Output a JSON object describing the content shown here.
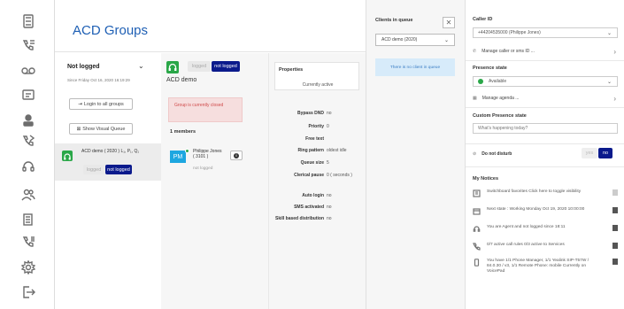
{
  "groups": {
    "title": "ACD Groups",
    "status_label": "Not logged",
    "since": "Since Friday Oct 16, 2020 16:19:29",
    "login_all_btn": "Login to all groups",
    "show_queue_btn": "Show Visual Queue",
    "group_name": "ACD demo ( 2020 ) L₁, P₁, Q₁",
    "group_logged": "logged",
    "group_not_logged": "not logged"
  },
  "detail": {
    "logged": "logged",
    "not_logged": "not logged",
    "name": "ACD demo",
    "closed_text": "Group is currently closed",
    "members_label": "1 members",
    "member_initials": "PM",
    "member_name": "Philippe Jones ( 3101 )",
    "member_status": "not logged"
  },
  "properties": {
    "title": "Properties",
    "status": "Currently active",
    "rows": [
      {
        "k": "Bypass DND",
        "v": "no"
      },
      {
        "k": "Priority",
        "v": "0"
      },
      {
        "k": "Free text",
        "v": ""
      },
      {
        "k": "Ring pattern",
        "v": "oldest idle"
      },
      {
        "k": "Queue size",
        "v": "5"
      },
      {
        "k": "Clerical pause",
        "v": "0 ( seconds )"
      },
      {
        "k": "Auto login",
        "v": "no"
      },
      {
        "k": "SMS activated",
        "v": "no"
      },
      {
        "k": "Skill based distribution",
        "v": "no"
      }
    ]
  },
  "queue": {
    "title": "Clients in queue",
    "select": "ACD demo (2020)",
    "empty": "There is no client in queue"
  },
  "right": {
    "caller_id_title": "Caller ID",
    "caller_id_value": "+44204535000 (Philippe Jones)",
    "manage_caller": "Manage caller or sms ID ...",
    "presence_title": "Presence state",
    "presence_value": "Available",
    "manage_agenda": "Manage agenda ...",
    "custom_presence_title": "Custom Presence state",
    "custom_presence_placeholder": "What's happening today?",
    "dnd_label": "Do not disturb",
    "dnd_yes": "yes",
    "dnd_no": "no",
    "notices_title": "My Notices",
    "notices": [
      {
        "icon": "favorites-icon",
        "text": "Switchboard favorites Click here to toggle visibility"
      },
      {
        "icon": "calendar-icon",
        "text": "Next state : Working Monday Oct 19, 2020 10:00:00"
      },
      {
        "icon": "headset-icon",
        "text": "You are Agent and not logged since 18:11"
      },
      {
        "icon": "call-rules-icon",
        "text": "0/7 active call rules 0/3 active to Services"
      },
      {
        "icon": "phone-icon",
        "text": "You have 1/1 Phone Manager, 1/1 Yealink SIP-T57W / 84.0.30 / v3, 1/1 Remote Phone: mobile Currently on VoicePad"
      }
    ]
  },
  "colors": {
    "accent": "#1e5fb4",
    "dark_blue": "#0b1a8c",
    "green": "#2aa748",
    "pm_badge": "#1ea7e0"
  }
}
